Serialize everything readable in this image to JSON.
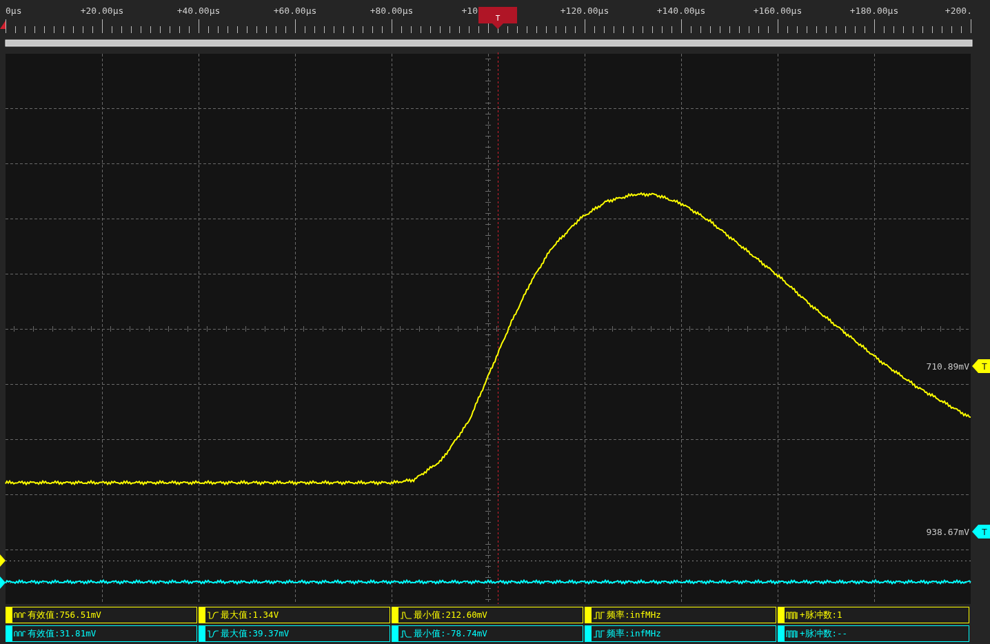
{
  "ruler": {
    "labels": [
      "0µs",
      "+20.00µs",
      "+40.00µs",
      "+60.00µs",
      "+80.00µs",
      "+10",
      "+120.00µs",
      "+140.00µs",
      "+160.00µs",
      "+180.00µs",
      "+200."
    ],
    "trigger_marker": "T"
  },
  "channels": [
    {
      "color": "#ffff00",
      "level_label": "710.89mV",
      "trigger_marker": "T"
    },
    {
      "color": "#00ffff",
      "level_label": "938.67mV",
      "trigger_marker": "T"
    }
  ],
  "measurements": [
    {
      "color": "#ffff00",
      "items": [
        {
          "kind": "rms",
          "label": "有效值:756.51mV"
        },
        {
          "kind": "max",
          "label": "最大值:1.34V"
        },
        {
          "kind": "min",
          "label": "最小值:212.60mV"
        },
        {
          "kind": "freq",
          "label": "频率:infMHz"
        },
        {
          "kind": "pulses",
          "label": "+脉冲数:1"
        }
      ]
    },
    {
      "color": "#00ffff",
      "items": [
        {
          "kind": "rms",
          "label": "有效值:31.81mV"
        },
        {
          "kind": "max",
          "label": "最大值:39.37mV"
        },
        {
          "kind": "min",
          "label": "最小值:-78.74mV"
        },
        {
          "kind": "freq",
          "label": "频率:infMHz"
        },
        {
          "kind": "pulses",
          "label": "+脉冲数:--"
        }
      ]
    }
  ]
}
